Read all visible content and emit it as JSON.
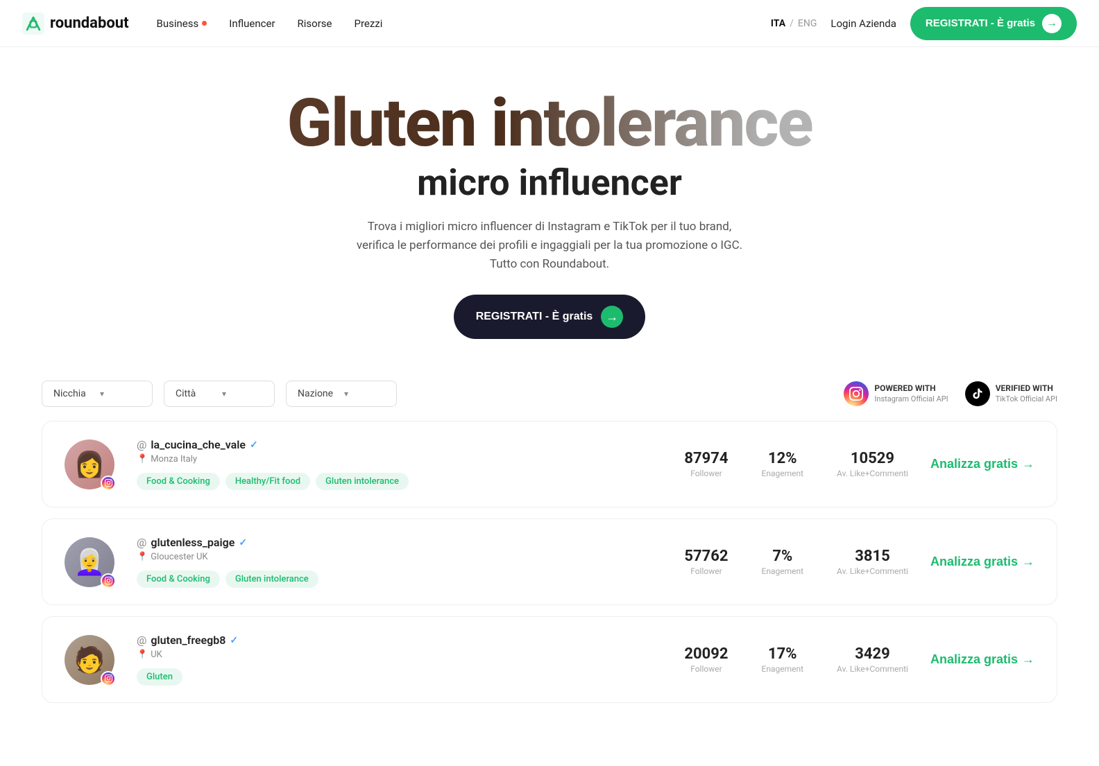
{
  "nav": {
    "logo_text": "roundabout",
    "links": [
      {
        "label": "Business",
        "has_dot": true
      },
      {
        "label": "Influencer",
        "has_dot": false
      },
      {
        "label": "Risorse",
        "has_dot": false
      },
      {
        "label": "Prezzi",
        "has_dot": false
      }
    ],
    "lang_active": "ITA",
    "lang_sep": "/",
    "lang_inactive": "ENG",
    "login_label": "Login Azienda",
    "register_label": "REGISTRATI - È gratis"
  },
  "hero": {
    "title_big": "Gluten intolerance",
    "title_sub": "micro influencer",
    "description": "Trova i migliori micro influencer di Instagram e TikTok per il tuo brand, verifica le performance dei profili e ingaggiali per la tua promozione o IGC. Tutto con Roundabout.",
    "cta_label": "REGISTRATI - È gratis"
  },
  "filters": {
    "nicchia_label": "Nicchia",
    "citta_label": "Città",
    "nazione_label": "Nazione"
  },
  "badges": [
    {
      "type": "ig",
      "powered_label": "POWERED WITH",
      "api_label": "Instagram Official API"
    },
    {
      "type": "tt",
      "powered_label": "VERIFIED WITH",
      "api_label": "TikTok Official API"
    }
  ],
  "influencers": [
    {
      "username": "la_cucina_che_vale",
      "verified": true,
      "city": "Monza",
      "country": "Italy",
      "platform": "ig",
      "stats": [
        {
          "value": "87974",
          "label": "Follower"
        },
        {
          "value": "12%",
          "label": "Enagement"
        },
        {
          "value": "10529",
          "label": "Av. Like+Commenti"
        }
      ],
      "tags": [
        "Food & Cooking",
        "Healthy/Fit food",
        "Gluten intolerance"
      ],
      "cta": "Analizza gratis"
    },
    {
      "username": "glutenless_paige",
      "verified": true,
      "city": "Gloucester",
      "country": "UK",
      "platform": "ig",
      "stats": [
        {
          "value": "57762",
          "label": "Follower"
        },
        {
          "value": "7%",
          "label": "Enagement"
        },
        {
          "value": "3815",
          "label": "Av. Like+Commenti"
        }
      ],
      "tags": [
        "Food & Cooking",
        "Gluten intolerance"
      ],
      "cta": "Analizza gratis"
    },
    {
      "username": "gluten_freegb8",
      "verified": true,
      "city": "",
      "country": "UK",
      "platform": "ig",
      "stats": [
        {
          "value": "20092",
          "label": "Follower"
        },
        {
          "value": "17%",
          "label": "Enagement"
        },
        {
          "value": "3429",
          "label": "Av. Like+Commenti"
        }
      ],
      "tags": [
        "Gluten"
      ],
      "cta": "Analizza gratis"
    }
  ],
  "icons": {
    "chevron_down": "▾",
    "arrow_right": "→",
    "location_pin": "📍",
    "verified": "✓",
    "instagram": "📷",
    "tiktok": "♪"
  },
  "colors": {
    "green": "#1dbb6e",
    "dark_btn": "#1a1a2e",
    "tag_bg": "#e8f8f0",
    "tag_text": "#1dbb6e"
  }
}
